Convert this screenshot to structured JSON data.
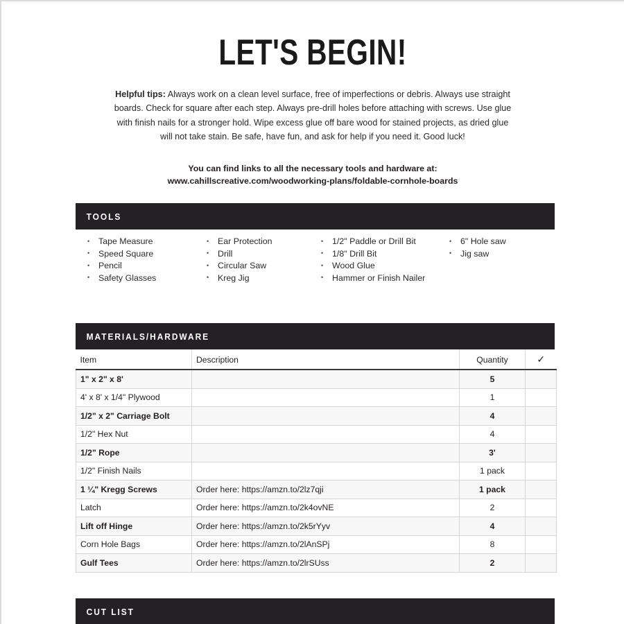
{
  "document": {
    "title": "LET'S BEGIN!",
    "tips_label": "Helpful tips:",
    "tips_body": " Always work on a clean level surface, free of imperfections or debris. Always use straight boards. Check for square after each step. Always pre-drill holes before attaching with screws. Use glue with finish nails for a stronger hold. Wipe excess glue off bare wood for stained projects, as dried glue will not take stain. Be safe, have fun, and ask for help if you need it. Good luck!",
    "links_intro": "You can find links to all the necessary tools and hardware at:",
    "links_url": "www.cahillscreative.com/woodworking-plans/foldable-cornhole-boards"
  },
  "sections": {
    "tools_heading": "TOOLS",
    "materials_heading": "MATERIALS/HARDWARE",
    "cutlist_heading": "CUT LIST"
  },
  "tools": {
    "columns": [
      [
        "Tape Measure",
        "Speed Square",
        "Pencil",
        "Safety Glasses"
      ],
      [
        "Ear Protection",
        "Drill",
        "Circular Saw",
        "Kreg Jig"
      ],
      [
        "1/2\" Paddle or Drill Bit",
        "1/8\" Drill Bit",
        "Wood Glue",
        "Hammer or Finish Nailer"
      ],
      [
        "6\" Hole saw",
        "Jig saw"
      ]
    ]
  },
  "materials": {
    "headers": {
      "item": "Item",
      "description": "Description",
      "quantity": "Quantity",
      "check": "✓"
    },
    "rows": [
      {
        "item": "1\" x 2\" x 8'",
        "description": "",
        "quantity": "5"
      },
      {
        "item": "4' x 8' x 1/4\" Plywood",
        "description": "",
        "quantity": "1"
      },
      {
        "item": "1/2\" x 2\" Carriage Bolt",
        "description": "",
        "quantity": "4"
      },
      {
        "item": "1/2\" Hex Nut",
        "description": "",
        "quantity": "4"
      },
      {
        "item": "1/2\" Rope",
        "description": "",
        "quantity": "3'"
      },
      {
        "item": "1/2\" Finish Nails",
        "description": "",
        "quantity": "1 pack"
      },
      {
        "item": "1 ¼\" Kregg Screws",
        "description": "Order here: https://amzn.to/2lz7qji",
        "quantity": "1 pack"
      },
      {
        "item": "Latch",
        "description": "Order here: https://amzn.to/2k4ovNE",
        "quantity": "2"
      },
      {
        "item": "Lift off Hinge",
        "description": "Order here: https://amzn.to/2k5rYyv",
        "quantity": "4"
      },
      {
        "item": "Corn Hole Bags",
        "description": "Order here: https://amzn.to/2lAnSPj",
        "quantity": "8"
      },
      {
        "item": "Gulf Tees",
        "description": "Order here: https://amzn.to/2lrSUss",
        "quantity": "2"
      }
    ]
  },
  "colors": {
    "bar_background": "#232123",
    "bar_text": "#ffffff",
    "body_text": "#231f20",
    "row_alt": "#f7f7f7",
    "table_border": "#d6d6d6"
  }
}
